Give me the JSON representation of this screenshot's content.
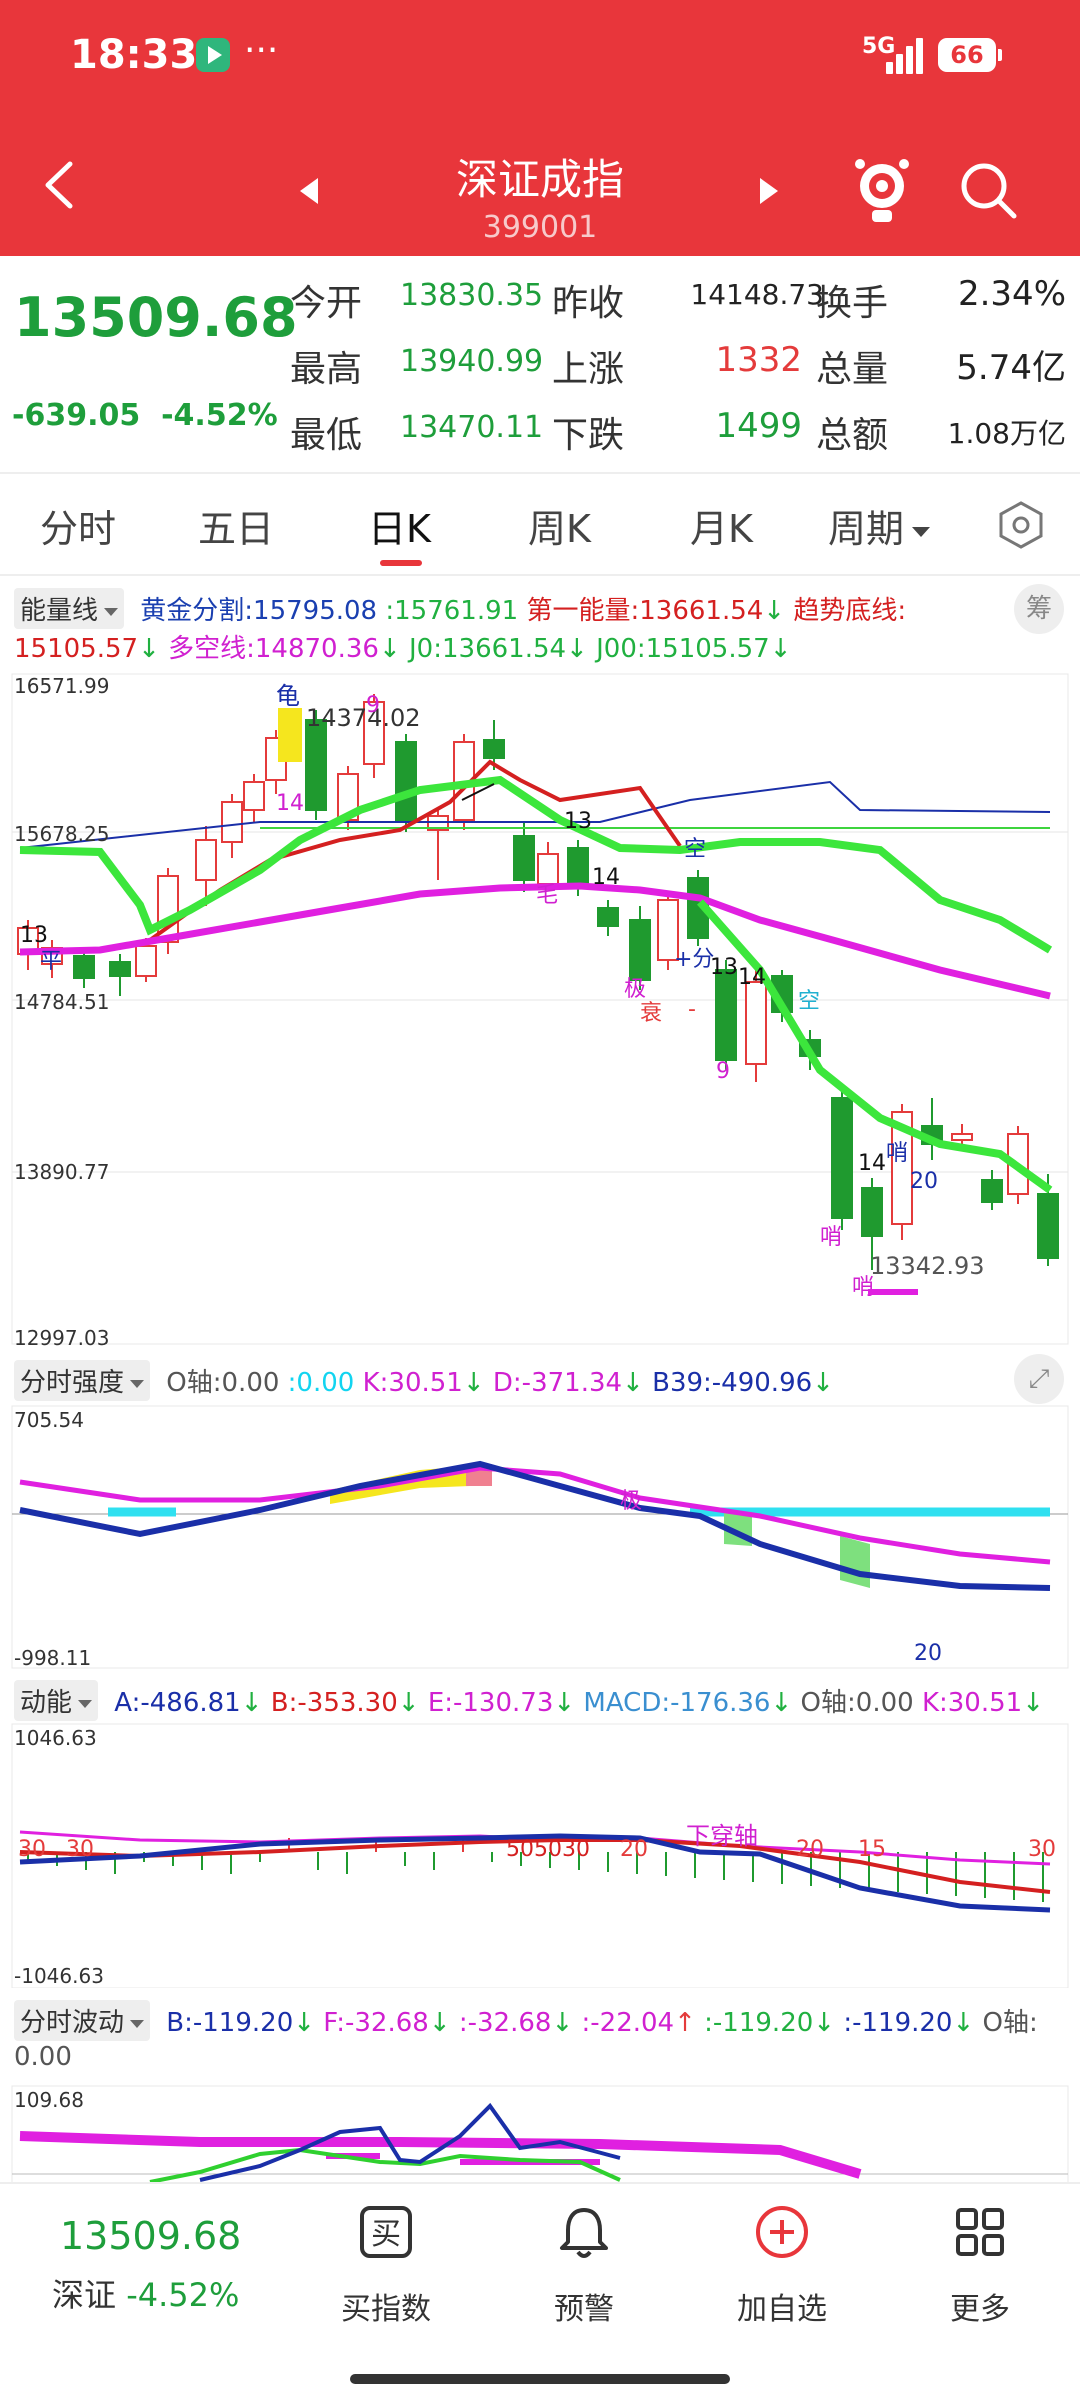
{
  "status": {
    "time": "18:33",
    "dots": "···",
    "network": "5G",
    "battery": "66"
  },
  "header": {
    "title": "深证成指",
    "code": "399001"
  },
  "quote": {
    "price": "13509.68",
    "change": "-639.05",
    "change_pct": "-4.52%",
    "open_label": "今开",
    "open": "13830.35",
    "prev_close_label": "昨收",
    "prev_close": "14148.73",
    "turnover_label": "换手",
    "turnover": "2.34%",
    "high_label": "最高",
    "high": "13940.99",
    "up_label": "上涨",
    "up_count": "1332",
    "volume_label": "总量",
    "volume": "5.74亿",
    "low_label": "最低",
    "low": "13470.11",
    "down_label": "下跌",
    "down_count": "1499",
    "amount_label": "总额",
    "amount": "1.08万亿"
  },
  "tabs": [
    {
      "label": "分时"
    },
    {
      "label": "五日"
    },
    {
      "label": "日K"
    },
    {
      "label": "周K"
    },
    {
      "label": "月K"
    },
    {
      "label": "周期"
    }
  ],
  "main_indicator": {
    "name": "能量线",
    "items": [
      {
        "text": "黄金分割:15795.08",
        "color": "#1a3fb0"
      },
      {
        "text": ":15761.91",
        "color": "#20b040"
      },
      {
        "text": "第一能量:13661.54",
        "color": "#d42020"
      },
      {
        "text": "↓",
        "color": "#20b040"
      },
      {
        "text": "趋势底线:",
        "color": "#d42020"
      }
    ],
    "items2": [
      {
        "text": "15105.57",
        "color": "#d42020"
      },
      {
        "text": "↓",
        "color": "#20b040"
      },
      {
        "text": "多空线:14870.36",
        "color": "#d020d0"
      },
      {
        "text": "↓",
        "color": "#20b040"
      },
      {
        "text": "J0:13661.54",
        "color": "#20b040"
      },
      {
        "text": "↓",
        "color": "#20b040"
      },
      {
        "text": "J00:15105.57",
        "color": "#20b040"
      },
      {
        "text": "↓",
        "color": "#20b040"
      }
    ],
    "badge": "筹",
    "axis": {
      "top": "16571.99",
      "l2": "15678.25",
      "l3": "14784.51",
      "l4": "13890.77",
      "bottom": "12997.03"
    },
    "labels": {
      "gui": "龟",
      "n14374": "14374.02",
      "n9": "9",
      "n14a": "14",
      "n13a": "13",
      "n13b": "13",
      "n14b": "14",
      "n13c": "13",
      "n14c": "14",
      "n9b": "9",
      "n14d": "14",
      "n20": "20",
      "n13342": "13342.93",
      "mao": "毛",
      "ping": "平",
      "kong": "空",
      "kong2": "空",
      "ji": "极",
      "shuai": "衰",
      "fen": "+分",
      "shao": "哨",
      "shao2": "哨",
      "shao3": "哨",
      "dash": "-"
    }
  },
  "ind2": {
    "name": "分时强度",
    "items": [
      {
        "text": "O轴:0.00",
        "color": "#555555"
      },
      {
        "text": ":0.00",
        "color": "#12d4f0"
      },
      {
        "text": "K:30.51",
        "color": "#d020d0"
      },
      {
        "text": "↓",
        "color": "#20b040"
      },
      {
        "text": "D:-371.34",
        "color": "#d020d0"
      },
      {
        "text": "↓",
        "color": "#20b040"
      },
      {
        "text": "B39:-490.96",
        "color": "#1a2fa8"
      },
      {
        "text": "↓",
        "color": "#20b040"
      }
    ],
    "axis": {
      "top": "705.54",
      "bottom": "-998.11"
    },
    "labels": {
      "ji": "极",
      "n20": "20"
    }
  },
  "ind3": {
    "name": "动能",
    "items": [
      {
        "text": "A:-486.81",
        "color": "#1a2fa8"
      },
      {
        "text": "↓",
        "color": "#20b040"
      },
      {
        "text": "B:-353.30",
        "color": "#d42020"
      },
      {
        "text": "↓",
        "color": "#20b040"
      },
      {
        "text": "E:-130.73",
        "color": "#d020d0"
      },
      {
        "text": "↓",
        "color": "#20b040"
      },
      {
        "text": "MACD:-176.36",
        "color": "#3a8fd0"
      },
      {
        "text": "↓",
        "color": "#20b040"
      },
      {
        "text": "O轴:0.00",
        "color": "#555555"
      },
      {
        "text": "K:30.51",
        "color": "#d020d0"
      },
      {
        "text": "↓",
        "color": "#20b040"
      }
    ],
    "axis": {
      "top": "1046.63",
      "bottom": "-1046.63"
    },
    "labels": {
      "n30a": "30",
      "n30b": "30",
      "n505030": "505030",
      "n20a": "20",
      "xuanzhou": "下穿轴",
      "n20b": "20",
      "n15": "15",
      "n30c": "30"
    }
  },
  "ind4": {
    "name": "分时波动",
    "items": [
      {
        "text": "B:-119.20",
        "color": "#1a2fa8"
      },
      {
        "text": "↓",
        "color": "#20b040"
      },
      {
        "text": "F:-32.68",
        "color": "#d020d0"
      },
      {
        "text": "↓",
        "color": "#20b040"
      },
      {
        "text": ":-32.68",
        "color": "#d020d0"
      },
      {
        "text": "↓",
        "color": "#20b040"
      },
      {
        "text": ":-22.04",
        "color": "#d020d0"
      },
      {
        "text": "↑",
        "color": "#e43b3b"
      },
      {
        "text": ":-119.20",
        "color": "#20b040"
      },
      {
        "text": "↓",
        "color": "#20b040"
      },
      {
        "text": ":-119.20",
        "color": "#1a2fa8"
      },
      {
        "text": "↓",
        "color": "#20b040"
      },
      {
        "text": "O轴:",
        "color": "#555555"
      }
    ],
    "o_value": "0.00",
    "axis": {
      "top": "109.68"
    }
  },
  "bottom_bar": {
    "price": "13509.68",
    "market": "深证",
    "pct": "-4.52%",
    "buy": "买指数",
    "alert": "预警",
    "add": "加自选",
    "more": "更多"
  }
}
